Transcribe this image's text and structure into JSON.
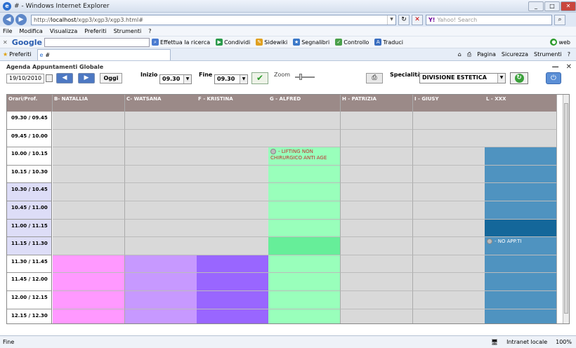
{
  "window": {
    "title": "# - Windows Internet Explorer"
  },
  "address": {
    "url_prefix": "http://",
    "url_host": "localhost",
    "url_path": "/xgp3/xgp3/xgp3.html#",
    "search_placeholder": "Yahoo! Search"
  },
  "menu": [
    "File",
    "Modifica",
    "Visualizza",
    "Preferiti",
    "Strumenti",
    "?"
  ],
  "gtoolbar": {
    "logo": "Google",
    "items": [
      "Effettua la ricerca",
      "Condividi",
      "Sidewiki",
      "Segnalibri",
      "Controllo",
      "Traduci"
    ],
    "right": [
      "web"
    ]
  },
  "favbar": {
    "favorites": "Preferiti",
    "tab": "#",
    "right": [
      "Pagina",
      "Sicurezza",
      "Strumenti"
    ]
  },
  "app": {
    "title": "Agenda Appuntamenti Globale",
    "date": "19/10/2010",
    "today_label": "Oggi",
    "start_label": "Inizio",
    "start_value": "09.30",
    "end_label": "Fine",
    "end_value": "09.30",
    "zoom_label": "Zoom",
    "specialty_label": "Specialità",
    "specialty_value": "DIVISIONE ESTETICA",
    "corner": "Orari/Prof.",
    "columns": [
      "B- NATALLIA",
      "C- WATSANA",
      "F - KRISTINA",
      "G - ALFRED",
      "H - PATRIZIA",
      "I - GIUSY",
      "L - XXX"
    ],
    "rows": [
      "09.30 / 09.45",
      "09.45 / 10.00",
      "10.00 / 10.15",
      "10.15 / 10.30",
      "10.30 / 10.45",
      "10.45 / 11.00",
      "11.00 / 11.15",
      "11.15 / 11.30",
      "11.30 / 11.45",
      "11.45 / 12.00",
      "12.00 / 12.15",
      "12.15 / 12.30"
    ],
    "appointments": [
      {
        "text": "- LIFTING NON CHIRURGICO ANTI AGE"
      },
      {
        "text": "- NO APP.TI"
      }
    ],
    "colors": {
      "natallia": "#ff99ff",
      "watsana": "#c799ff",
      "kristina": "#9966ff",
      "alfred": "#99ffbb",
      "alfred_dark": "#66ee99",
      "xxx": "#4f93c0",
      "xxx_dark": "#14679a"
    }
  },
  "status": {
    "left": "Fine",
    "zone": "Intranet locale",
    "zoom": "100%"
  }
}
